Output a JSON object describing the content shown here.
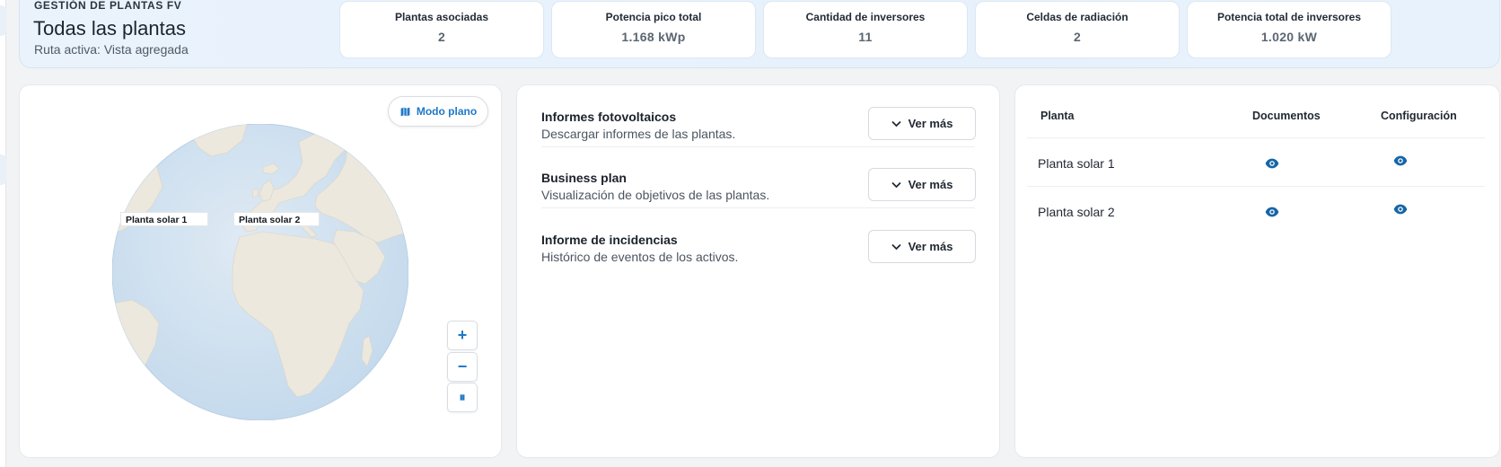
{
  "header": {
    "kicker": "GESTIÓN DE PLANTAS FV",
    "title": "Todas las plantas",
    "subtitle": "Ruta activa: Vista agregada",
    "kpis": [
      {
        "label": "Plantas asociadas",
        "value": "2"
      },
      {
        "label": "Potencia pico total",
        "value": "1.168 kWp"
      },
      {
        "label": "Cantidad de inversores",
        "value": "11"
      },
      {
        "label": "Celdas de radiación",
        "value": "2"
      },
      {
        "label": "Potencia total de inversores",
        "value": "1.020 kW"
      }
    ]
  },
  "map": {
    "flat_mode_label": "Modo plano",
    "markers": [
      {
        "label": "Planta solar 1"
      },
      {
        "label": "Planta solar 2"
      }
    ],
    "controls": {
      "zoom_in": "+",
      "zoom_out": "−",
      "pause": "⏸"
    }
  },
  "reports": {
    "items": [
      {
        "title": "Informes fotovoltaicos",
        "description": "Descargar informes de las plantas.",
        "button": "Ver más"
      },
      {
        "title": "Business plan",
        "description": "Visualización de objetivos de las plantas.",
        "button": "Ver más"
      },
      {
        "title": "Informe de incidencias",
        "description": "Histórico de eventos de los activos.",
        "button": "Ver más"
      }
    ]
  },
  "plants_table": {
    "columns": [
      "Planta",
      "Documentos",
      "Configuración"
    ],
    "rows": [
      {
        "name": "Planta solar 1"
      },
      {
        "name": "Planta solar 2"
      }
    ]
  },
  "colors": {
    "accent": "#1e78c8",
    "eye_icon": "#1565a8"
  }
}
